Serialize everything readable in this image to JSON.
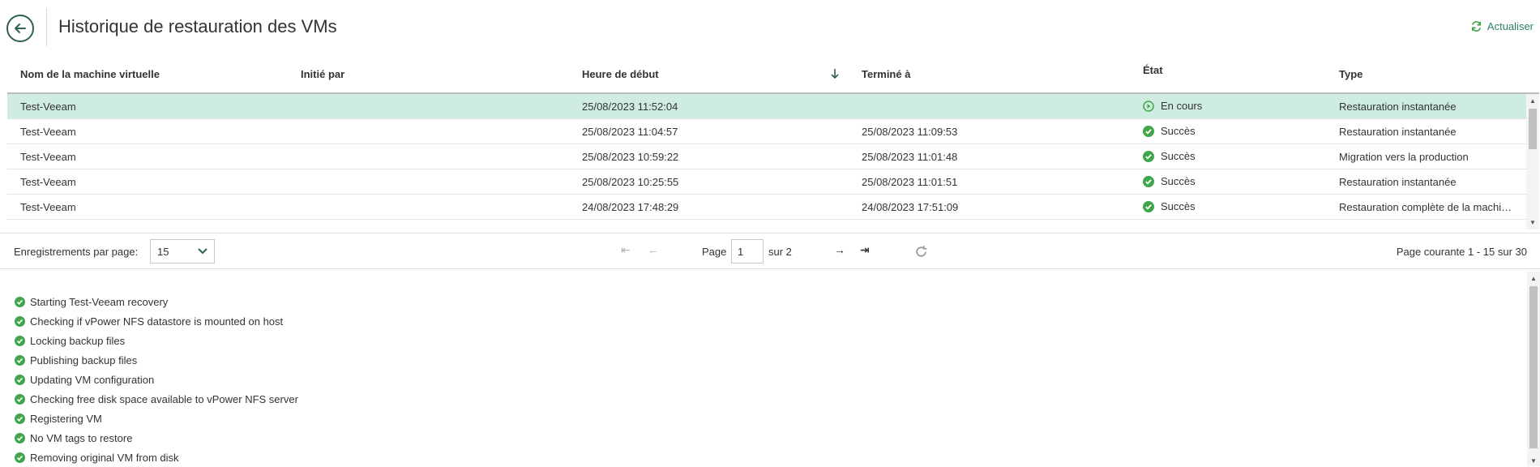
{
  "header": {
    "title": "Historique de restauration des VMs",
    "refresh_label": "Actualiser"
  },
  "grid": {
    "columns": [
      "Nom de la machine virtuelle",
      "Initié par",
      "Heure de début",
      "Terminé à",
      "État",
      "Type"
    ],
    "sort_column": "Heure de début",
    "sort_direction": "descending",
    "rows": [
      {
        "vm": "Test-Veeam",
        "initiated_by": "",
        "start": "25/08/2023 11:52:04",
        "end": "",
        "state": "En cours",
        "state_icon": "play-circle-icon",
        "type": "Restauration instantanée"
      },
      {
        "vm": "Test-Veeam",
        "initiated_by": "",
        "start": "25/08/2023 11:04:57",
        "end": "25/08/2023 11:09:53",
        "state": "Succès",
        "state_icon": "check-circle-icon",
        "type": "Restauration instantanée"
      },
      {
        "vm": "Test-Veeam",
        "initiated_by": "",
        "start": "25/08/2023 10:59:22",
        "end": "25/08/2023 11:01:48",
        "state": "Succès",
        "state_icon": "check-circle-icon",
        "type": "Migration vers la production"
      },
      {
        "vm": "Test-Veeam",
        "initiated_by": "",
        "start": "25/08/2023 10:25:55",
        "end": "25/08/2023 11:01:51",
        "state": "Succès",
        "state_icon": "check-circle-icon",
        "type": "Restauration instantanée"
      },
      {
        "vm": "Test-Veeam",
        "initiated_by": "",
        "start": "24/08/2023 17:48:29",
        "end": "24/08/2023 17:51:09",
        "state": "Succès",
        "state_icon": "check-circle-icon",
        "type": "Restauration complète de la machine virtuelle"
      }
    ]
  },
  "pager": {
    "per_page_label": "Enregistrements par page:",
    "per_page_value": "15",
    "page_label": "Page",
    "page_value": "1",
    "of_label": "sur 2",
    "current_label": "Page courante 1 - 15 sur 30"
  },
  "log": {
    "items": [
      "Starting Test-Veeam recovery",
      "Checking if vPower NFS datastore is mounted on host",
      "Locking backup files",
      "Publishing backup files",
      "Updating VM configuration",
      "Checking free disk space available to vPower NFS server",
      "Registering VM",
      "No VM tags to restore",
      "Removing original VM from disk"
    ]
  },
  "colors": {
    "accent": "#2e7d6b",
    "success": "#3fa64a",
    "selected_row": "#cfece0"
  }
}
